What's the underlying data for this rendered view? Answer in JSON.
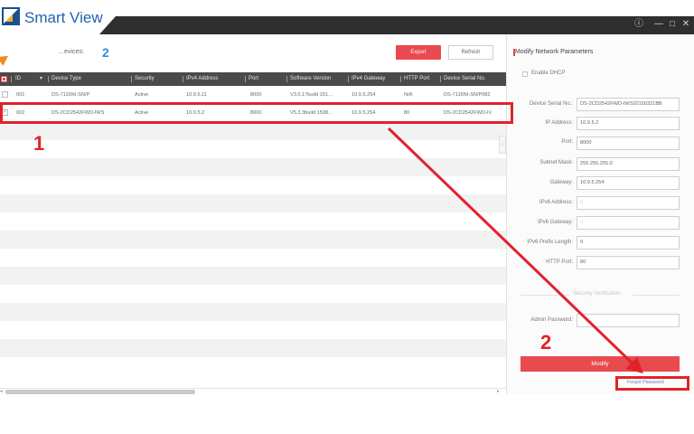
{
  "app": {
    "name": "Smart View",
    "logo_icon": "smartview-logo-icon",
    "window_controls": [
      "ⓘ",
      "—",
      "□",
      "✕"
    ]
  },
  "toolbar": {
    "online_devices_label": "…evices:",
    "online_devices_count": "2",
    "export_label": "Export",
    "refresh_label": "Refresh"
  },
  "table": {
    "columns": [
      "ID",
      "Device Type",
      "Security",
      "IPv4 Address",
      "Port",
      "Software Version",
      "IPv4 Gateway",
      "HTTP Port",
      "Device Serial No."
    ],
    "rows": [
      {
        "id": "001",
        "device_type": "DS-7116NI-SN/P",
        "security": "Active",
        "ipv4": "10.9.5.11",
        "port": "8000",
        "software": "V3.0.17build 151…",
        "gateway": "10.9.5.254",
        "http_port": "N/A",
        "serial": "DS-7116NI-SN/P082",
        "checked": false
      },
      {
        "id": "002",
        "device_type": "DS-2CD2542FWD-IWS",
        "security": "Active",
        "ipv4": "10.9.5.2",
        "port": "8000",
        "software": "V5.3.3build 1508…",
        "gateway": "10.9.5.254",
        "http_port": "80",
        "serial": "DS-2CD2542FWD-IV",
        "checked": true
      }
    ],
    "empty_row_count": 14
  },
  "panel": {
    "title": "Modify Network Parameters",
    "enable_dhcp_label": "Enable DHCP",
    "fields": [
      {
        "label": "Device Serial No.:",
        "value": "DS-2CD2542FWD-IWS20150321BB"
      },
      {
        "label": "IP Address:",
        "value": "10.9.5.2"
      },
      {
        "label": "Port:",
        "value": "8000"
      },
      {
        "label": "Subnet Mask:",
        "value": "255.255.255.0"
      },
      {
        "label": "Gateway:",
        "value": "10.9.5.254"
      },
      {
        "label": "IPv6 Address:",
        "value": "::"
      },
      {
        "label": "IPv6 Gateway:",
        "value": "::"
      },
      {
        "label": "IPv6 Prefix Length:",
        "value": "0"
      },
      {
        "label": "HTTP Port:",
        "value": "80"
      }
    ],
    "security_section_label": "Security Verification",
    "admin_password_label": "Admin Password:",
    "admin_password_value": "",
    "modify_label": "Modify",
    "forgot_password_label": "Forgot Password"
  },
  "annotations": {
    "step1": "1",
    "step2": "2",
    "color": "#e0232b"
  },
  "colors": {
    "accent_red": "#e84a4f",
    "header_dark": "#4a4a4a",
    "brand_blue": "#1e63b0"
  }
}
